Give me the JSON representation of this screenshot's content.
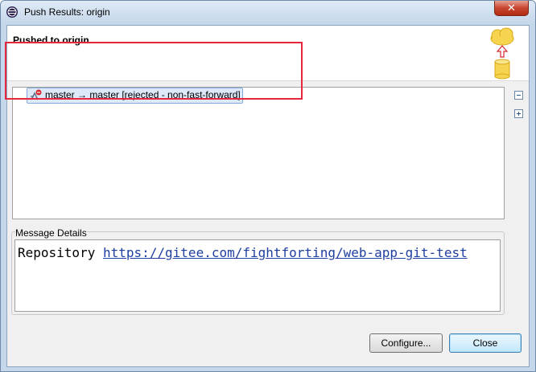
{
  "window": {
    "title": "Push Results: origin"
  },
  "header": {
    "title": "Pushed to origin"
  },
  "tree": {
    "items": [
      {
        "label": "master → master [rejected - non-fast-forward]"
      }
    ]
  },
  "message_details": {
    "label": "Message Details",
    "prefix": "Repository",
    "url": "https://gitee.com/fightforting/web-app-git-test"
  },
  "buttons": {
    "configure": "Configure...",
    "close": "Close"
  },
  "icons": {
    "app": "eclipse-icon",
    "titlebar_close": "close-icon",
    "push": "cloud-upload-icon",
    "ref": "rejected-ref-icon",
    "collapse": "collapse-all-icon",
    "expand": "expand-all-icon"
  },
  "colors": {
    "highlight": "#e8273e",
    "link": "#1f3fa0",
    "selection": "#dde9f8"
  }
}
